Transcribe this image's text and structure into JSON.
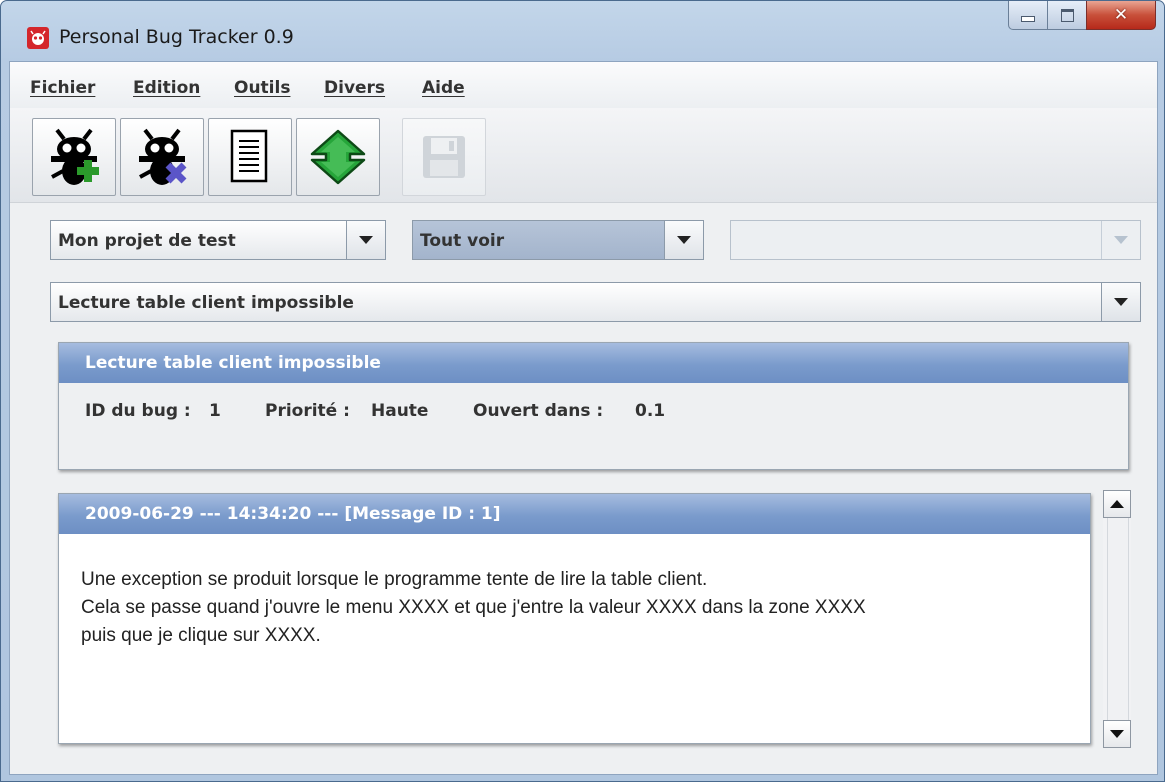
{
  "window": {
    "title": "Personal Bug Tracker 0.9",
    "accent_color": "#d4262b"
  },
  "menu": [
    "Fichier",
    "Edition",
    "Outils",
    "Divers",
    "Aide"
  ],
  "toolbar": {
    "buttons": [
      {
        "icon": "add-bug-icon",
        "enabled": true
      },
      {
        "icon": "delete-bug-icon",
        "enabled": true
      },
      {
        "icon": "document-icon",
        "enabled": true
      },
      {
        "icon": "sync-arrows-icon",
        "enabled": true
      },
      {
        "icon": "save-floppy-icon",
        "enabled": false
      }
    ]
  },
  "filters": {
    "project": "Mon projet de test",
    "view_filter": "Tout voir",
    "third": ""
  },
  "bug_select": "Lecture table client impossible",
  "bug": {
    "title": "Lecture table client impossible",
    "id_label": "ID du bug :",
    "id": "1",
    "priority_label": "Priorité :",
    "priority": "Haute",
    "opened_label": "Ouvert dans :",
    "opened": "0.1"
  },
  "message": {
    "header": "2009-06-29 --- 14:34:20 --- [Message ID : 1]",
    "lines": [
      "Une exception se produit lorsque le programme tente de lire la table client.",
      "Cela se passe quand j'ouvre le menu XXXX et que j'entre la valeur XXXX dans la zone XXXX",
      "puis que je clique sur XXXX."
    ]
  },
  "colors": {
    "panel_header": "#7a9bcc",
    "selected_combo": "#a3b4cc"
  }
}
